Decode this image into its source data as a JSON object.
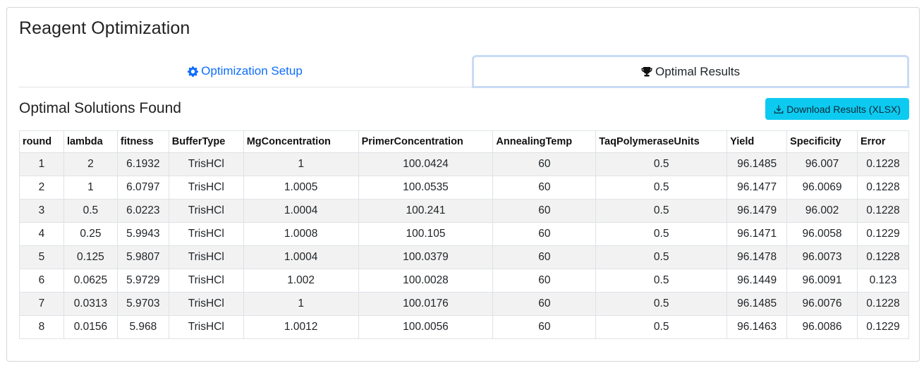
{
  "page": {
    "title": "Reagent Optimization",
    "section_title": "Optimal Solutions Found"
  },
  "tabs": [
    {
      "label": "Optimization Setup",
      "icon": "gear-icon",
      "active": false
    },
    {
      "label": "Optimal Results",
      "icon": "trophy-icon",
      "active": true
    }
  ],
  "download_button": {
    "label": "Download Results (XLSX)",
    "icon": "download-icon"
  },
  "colors": {
    "accent": "#0d6efd",
    "button": "#0dcaf0",
    "active_tab_border": "#c9dbf4"
  },
  "table": {
    "headers": [
      "round",
      "lambda",
      "fitness",
      "BufferType",
      "MgConcentration",
      "PrimerConcentration",
      "AnnealingTemp",
      "TaqPolymeraseUnits",
      "Yield",
      "Specificity",
      "Error"
    ],
    "rows": [
      [
        "1",
        "2",
        "6.1932",
        "TrisHCl",
        "1",
        "100.0424",
        "60",
        "0.5",
        "96.1485",
        "96.007",
        "0.1228"
      ],
      [
        "2",
        "1",
        "6.0797",
        "TrisHCl",
        "1.0005",
        "100.0535",
        "60",
        "0.5",
        "96.1477",
        "96.0069",
        "0.1228"
      ],
      [
        "3",
        "0.5",
        "6.0223",
        "TrisHCl",
        "1.0004",
        "100.241",
        "60",
        "0.5",
        "96.1479",
        "96.002",
        "0.1228"
      ],
      [
        "4",
        "0.25",
        "5.9943",
        "TrisHCl",
        "1.0008",
        "100.105",
        "60",
        "0.5",
        "96.1471",
        "96.0058",
        "0.1229"
      ],
      [
        "5",
        "0.125",
        "5.9807",
        "TrisHCl",
        "1.0004",
        "100.0379",
        "60",
        "0.5",
        "96.1478",
        "96.0073",
        "0.1228"
      ],
      [
        "6",
        "0.0625",
        "5.9729",
        "TrisHCl",
        "1.002",
        "100.0028",
        "60",
        "0.5",
        "96.1449",
        "96.0091",
        "0.123"
      ],
      [
        "7",
        "0.0313",
        "5.9703",
        "TrisHCl",
        "1",
        "100.0176",
        "60",
        "0.5",
        "96.1485",
        "96.0076",
        "0.1228"
      ],
      [
        "8",
        "0.0156",
        "5.968",
        "TrisHCl",
        "1.0012",
        "100.0056",
        "60",
        "0.5",
        "96.1463",
        "96.0086",
        "0.1229"
      ]
    ]
  }
}
